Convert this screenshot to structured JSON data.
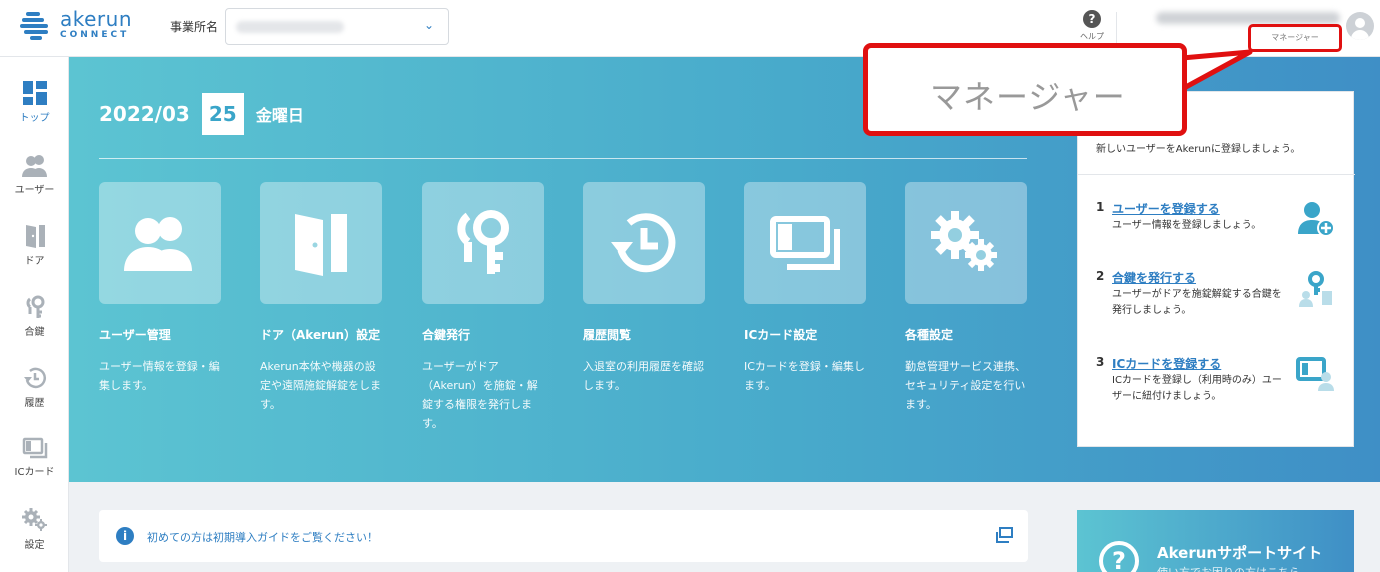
{
  "header": {
    "logo_main": "akerun",
    "logo_sub": "CONNECT",
    "office_label": "事業所名",
    "help_label": "ヘルプ",
    "role_label": "マネージャー"
  },
  "sidebar": {
    "items": [
      {
        "label": "トップ"
      },
      {
        "label": "ユーザー"
      },
      {
        "label": "ドア"
      },
      {
        "label": "合鍵"
      },
      {
        "label": "履歴"
      },
      {
        "label": "ICカード"
      },
      {
        "label": "設定"
      }
    ]
  },
  "hero": {
    "year_month": "2022/03",
    "day": "25",
    "weekday": "金曜日",
    "cards": [
      {
        "title": "ユーザー管理",
        "desc": "ユーザー情報を登録・編集します。"
      },
      {
        "title": "ドア（Akerun）設定",
        "desc": "Akerun本体や機器の設定や遠隔施錠解錠をします。"
      },
      {
        "title": "合鍵発行",
        "desc": "ユーザーがドア（Akerun）を施錠・解錠する権限を発行します。"
      },
      {
        "title": "履歴閲覧",
        "desc": "入退室の利用履歴を確認します。"
      },
      {
        "title": "ICカード設定",
        "desc": "ICカードを登録・編集します。"
      },
      {
        "title": "各種設定",
        "desc": "勤怠管理サービス連携、セキュリティ設定を行います。"
      }
    ]
  },
  "callout": {
    "text": "マネージャー"
  },
  "panel": {
    "intro": "新しいユーザーをAkerunに登録しましょう。",
    "steps": [
      {
        "num": "1",
        "title": "ユーザーを登録する",
        "desc": "ユーザー情報を登録しましょう。"
      },
      {
        "num": "2",
        "title": "合鍵を発行する",
        "desc": "ユーザーがドアを施錠解錠する合鍵を発行しましょう。"
      },
      {
        "num": "3",
        "title": "ICカードを登録する",
        "desc": "ICカードを登録し（利用時のみ）ユーザーに紐付けましょう。"
      }
    ]
  },
  "guide": {
    "text": "初めての方は初期導入ガイドをご覧ください！"
  },
  "support": {
    "title": "Akerunサポートサイト",
    "subtitle": "使い方でお困りの方はこちら"
  }
}
